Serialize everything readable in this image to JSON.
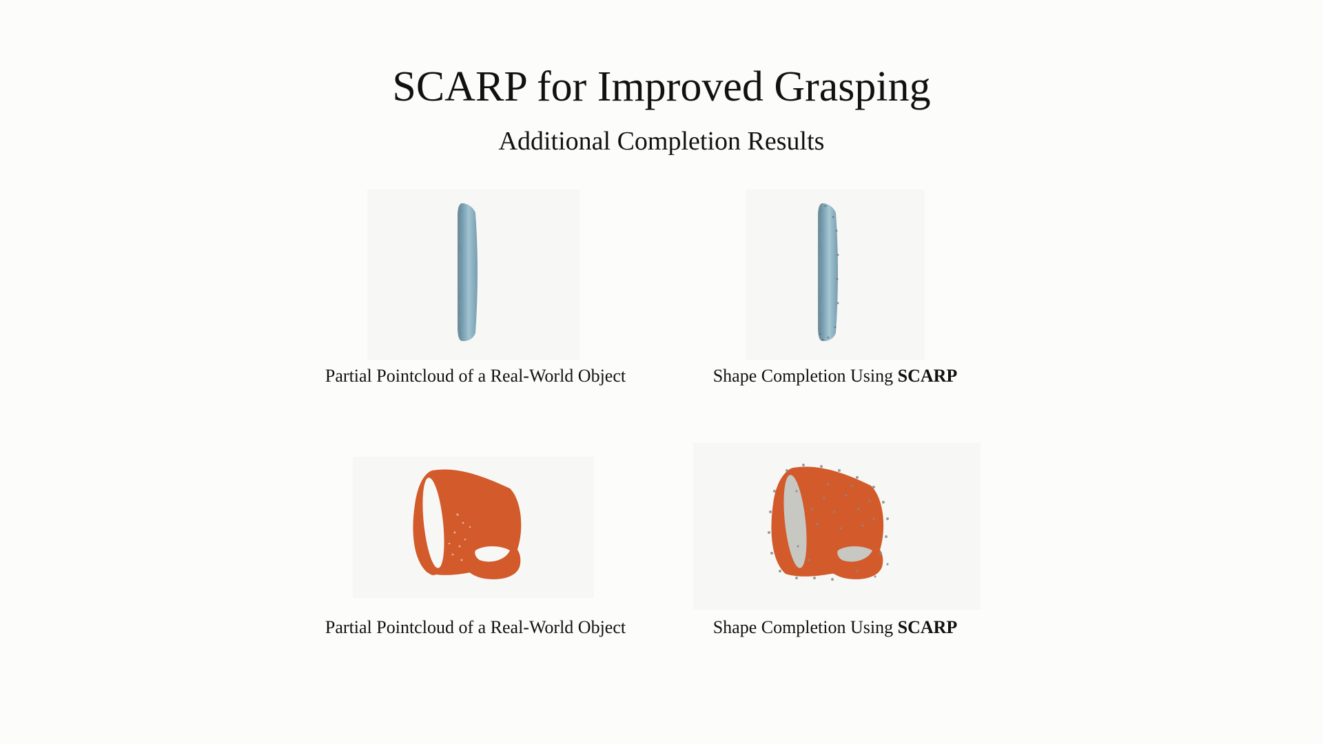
{
  "page": {
    "title": "SCARP for Improved Grasping",
    "subtitle": "Additional Completion Results"
  },
  "rows": [
    {
      "left": {
        "caption": "Partial Pointcloud of a Real-World Object",
        "object": "plate",
        "color": "#7fa6b8"
      },
      "right": {
        "caption_prefix": "Shape Completion Using ",
        "caption_bold": "SCARP",
        "object": "plate",
        "color": "#7fa6b8"
      }
    },
    {
      "left": {
        "caption": "Partial Pointcloud of a Real-World Object",
        "object": "mug",
        "color": "#d25a2b"
      },
      "right": {
        "caption_prefix": "Shape Completion Using ",
        "caption_bold": "SCARP",
        "object": "mug",
        "color": "#d25a2b"
      }
    }
  ],
  "colors": {
    "background": "#fcfcfa",
    "plate": "#7fa6b8",
    "mug": "#d25a2b",
    "completion_points": "#8a8a8a"
  }
}
